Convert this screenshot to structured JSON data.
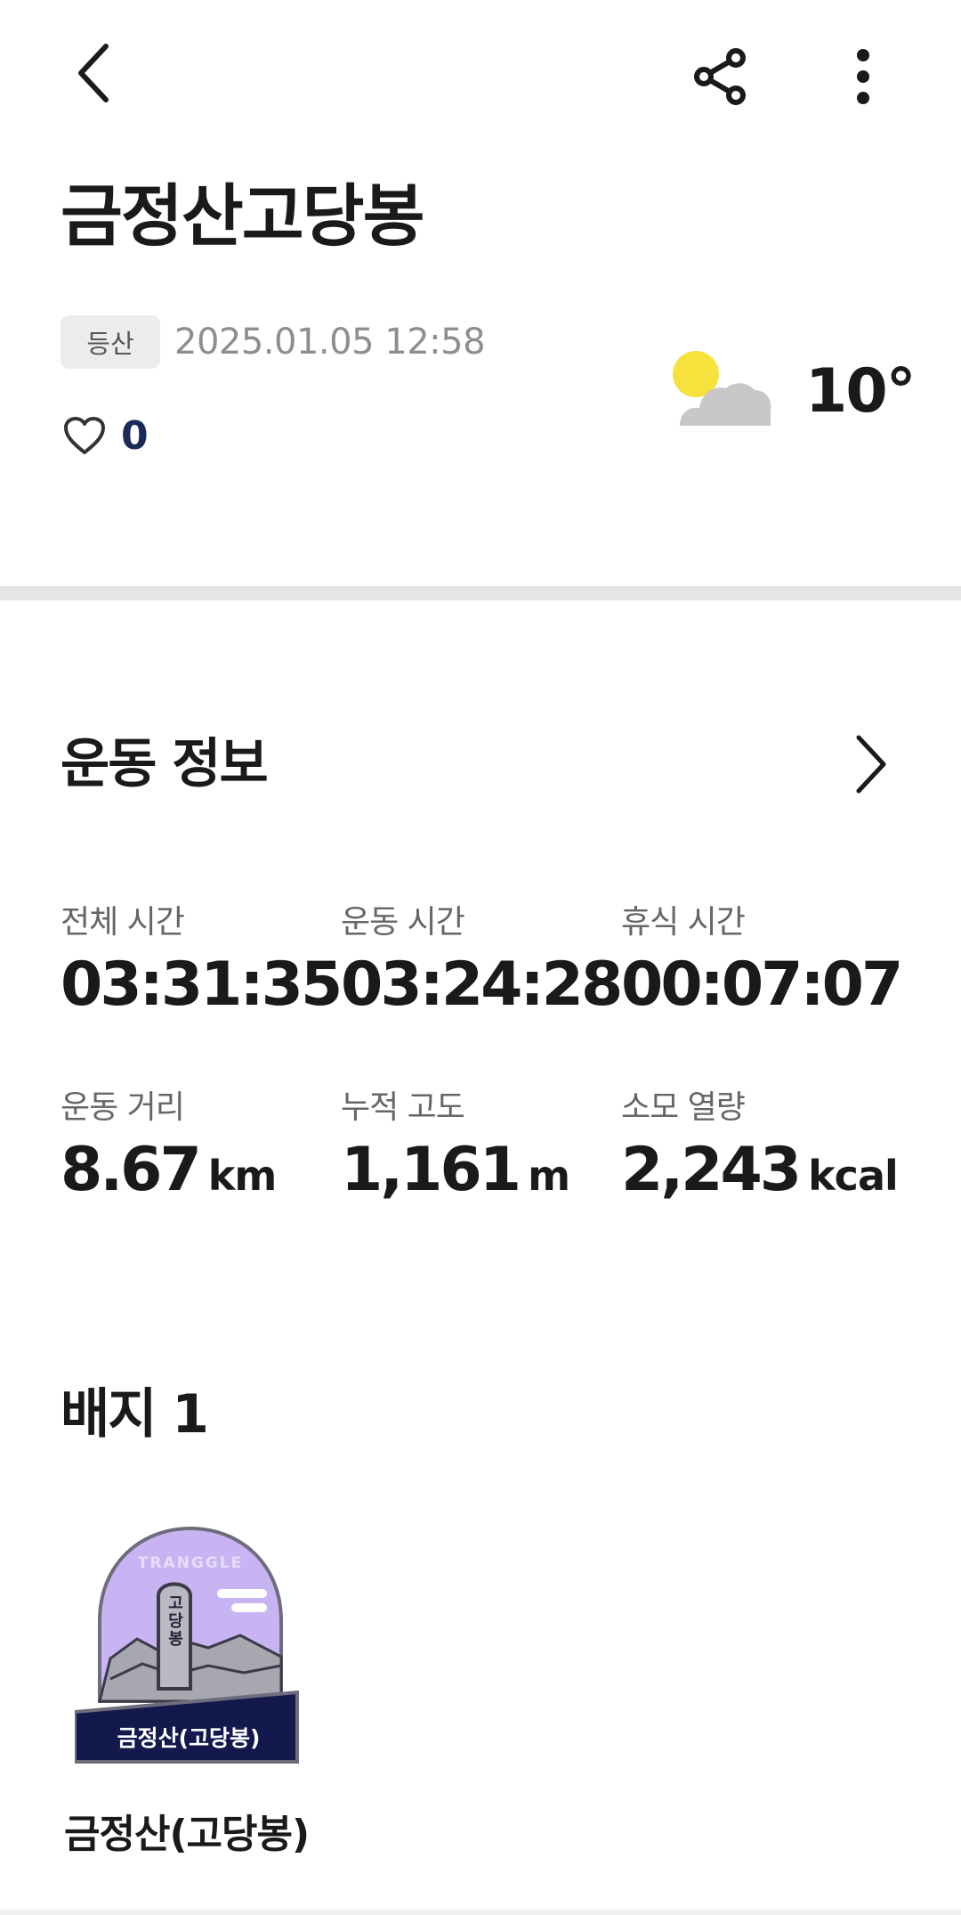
{
  "header": {
    "back_icon": "chevron-left-icon",
    "share_icon": "share-icon",
    "more_icon": "more-vertical-icon"
  },
  "activity": {
    "title": "금정산고당봉",
    "type_tag": "등산",
    "datetime": "2025.01.05 12:58",
    "like_icon": "heart-outline-icon",
    "like_count": "0"
  },
  "weather": {
    "icon": "partly-cloudy-icon",
    "temperature": "10°"
  },
  "exercise": {
    "section_title": "운동 정보",
    "arrow_icon": "chevron-right-icon",
    "stats": [
      {
        "label": "전체 시간",
        "value": "03:31:35",
        "unit": ""
      },
      {
        "label": "운동 시간",
        "value": "03:24:28",
        "unit": ""
      },
      {
        "label": "휴식 시간",
        "value": "00:07:07",
        "unit": ""
      },
      {
        "label": "운동 거리",
        "value": "8.67",
        "unit": "km"
      },
      {
        "label": "누적 고도",
        "value": "1,161",
        "unit": "m"
      },
      {
        "label": "소모 열량",
        "value": "2,243",
        "unit": "kcal"
      }
    ]
  },
  "badges": {
    "section_title": "배지 1",
    "items": [
      {
        "name": "금정산(고당봉)",
        "badge_brand": "TRANGGLE",
        "badge_banner": "금정산(고당봉)",
        "stone_text": "고당봉"
      }
    ]
  },
  "colors": {
    "badge_purple": "#c9b4f3",
    "badge_navy": "#13194d",
    "sun_yellow": "#f7e13c",
    "cloud_gray": "#c8c8c8"
  }
}
